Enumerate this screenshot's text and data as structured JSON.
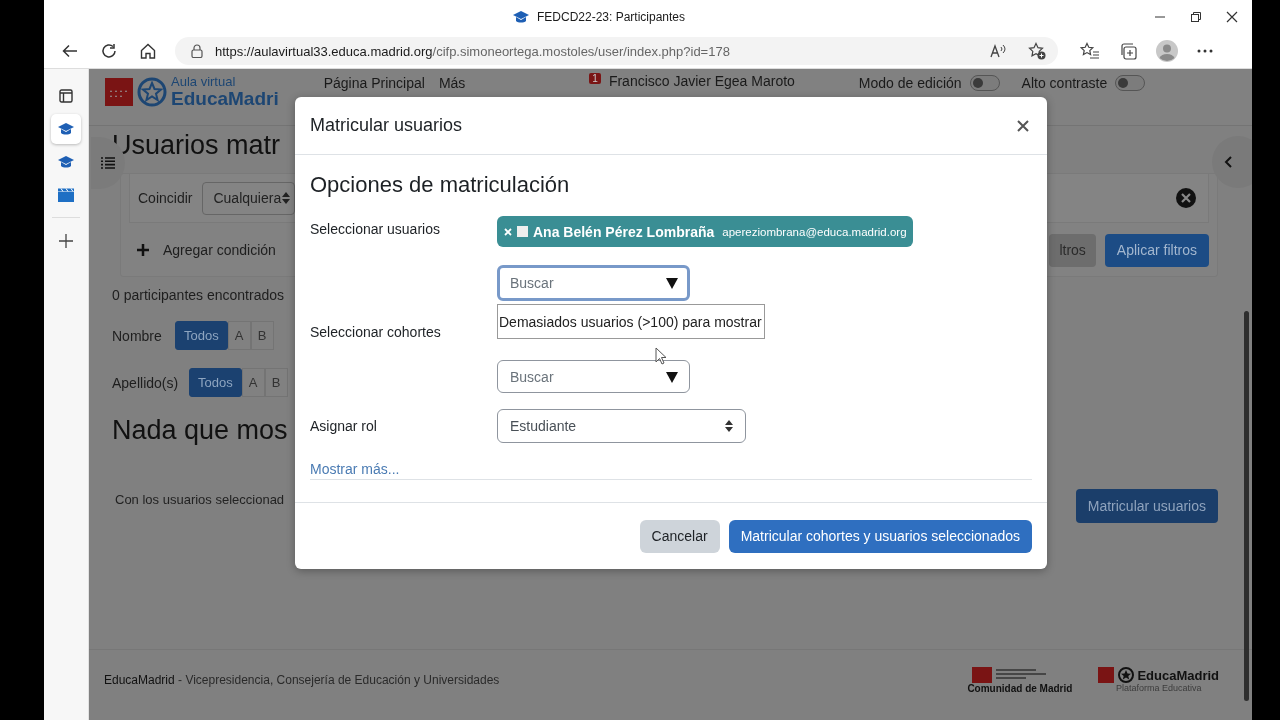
{
  "browser": {
    "title": "FEDCD22-23: Participantes",
    "url_host": "https://aulavirtual33.educa.madrid.org",
    "url_path": "/cifp.simoneortega.mostoles/user/index.php?id=178"
  },
  "vertical_tabs": [
    {
      "kind": "cap",
      "selected": true
    },
    {
      "kind": "cap",
      "selected": false
    },
    {
      "kind": "film",
      "selected": false
    }
  ],
  "header": {
    "logo_small": "Aula virtual",
    "logo_large": "EducaMadri",
    "nav": [
      "Página Principal",
      "Más"
    ],
    "notification_count": "1",
    "user": "Francisco Javier Egea Maroto",
    "toggles": [
      {
        "label": "Modo de edición",
        "on": false
      },
      {
        "label": "Alto contraste",
        "on": false
      }
    ]
  },
  "page_title": "Usuarios matr",
  "filters": {
    "match_label": "Coincidir",
    "match_value": "Cualquiera",
    "add_condition": "Agregar condición",
    "clear_button": "ltros",
    "apply_button": "Aplicar filtros"
  },
  "participants_count": "0 participantes encontrados",
  "initials_bars": [
    {
      "label": "Nombre",
      "items": [
        {
          "text": "Todos",
          "selected": true
        },
        {
          "text": "A",
          "selected": false
        },
        {
          "text": "B",
          "selected": false
        }
      ]
    },
    {
      "label": "Apellido(s)",
      "items": [
        {
          "text": "Todos",
          "selected": true
        },
        {
          "text": "A",
          "selected": false
        },
        {
          "text": "B",
          "selected": false
        }
      ]
    }
  ],
  "empty_message": "Nada que mos",
  "bulk_actions": "Con los usuarios seleccionad",
  "enrol_button": "Matricular usuarios",
  "footer": {
    "text": "**EducaMadrid** - Vicepresidencia, Consejería de Educación y Universidades",
    "region_logo": "Comunidad de Madrid",
    "brand_logo": "EducaMadrid",
    "brand_tagline": "Plataforma Educativa"
  },
  "modal": {
    "title": "Matricular usuarios",
    "heading": "Opciones de matriculación",
    "fields": [
      {
        "kind": "autocomplete",
        "label": "Seleccionar usuarios",
        "chips": [
          {
            "name": "Ana Belén Pérez Lombraña",
            "email": "apereziombrana@educa.madrid.org"
          }
        ],
        "placeholder": "Buscar",
        "focused": true,
        "message": "Demasiados usuarios (>100) para mostrar"
      },
      {
        "kind": "autocomplete",
        "label": "Seleccionar cohortes",
        "placeholder": "Buscar",
        "focused": false
      },
      {
        "kind": "select",
        "label": "Asignar rol",
        "value": "Estudiante"
      }
    ],
    "more_link": "Mostrar más...",
    "buttons": [
      {
        "label": "Cancelar",
        "kind": "secondary"
      },
      {
        "label": "Matricular cohortes y usuarios seleccionados",
        "kind": "primary"
      }
    ]
  }
}
